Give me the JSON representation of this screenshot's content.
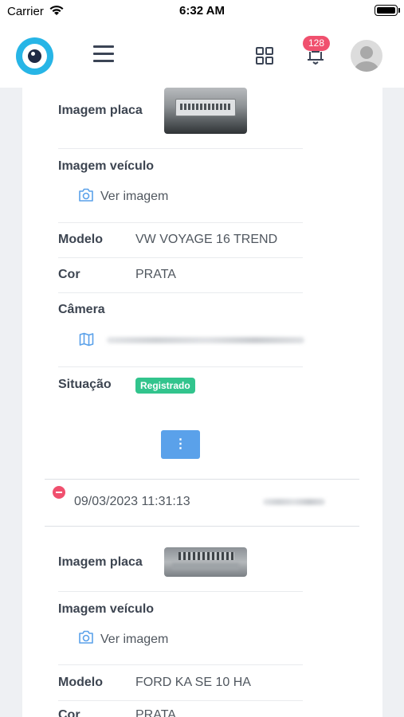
{
  "status_bar": {
    "carrier": "Carrier",
    "time": "6:32 AM"
  },
  "header": {
    "notification_count": "128"
  },
  "records": [
    {
      "plate_image_label": "Imagem placa",
      "vehicle_image_label": "Imagem veículo",
      "view_image_link": "Ver imagem",
      "model_label": "Modelo",
      "model_value": "VW VOYAGE 16 TREND",
      "color_label": "Cor",
      "color_value": "PRATA",
      "camera_label": "Câmera",
      "status_label": "Situação",
      "status_value": "Registrado",
      "more_button": "⋮"
    },
    {
      "timestamp": "09/03/2023 11:31:13",
      "plate_image_label": "Imagem placa",
      "vehicle_image_label": "Imagem veículo",
      "view_image_link": "Ver imagem",
      "model_label": "Modelo",
      "model_value": "FORD KA SE 10 HA",
      "color_label": "Cor",
      "color_value": "PRATA"
    }
  ],
  "colors": {
    "accent": "#5aa1ea",
    "logo": "#27b5e6",
    "badge": "#f0506e",
    "registered": "#32c48d"
  }
}
